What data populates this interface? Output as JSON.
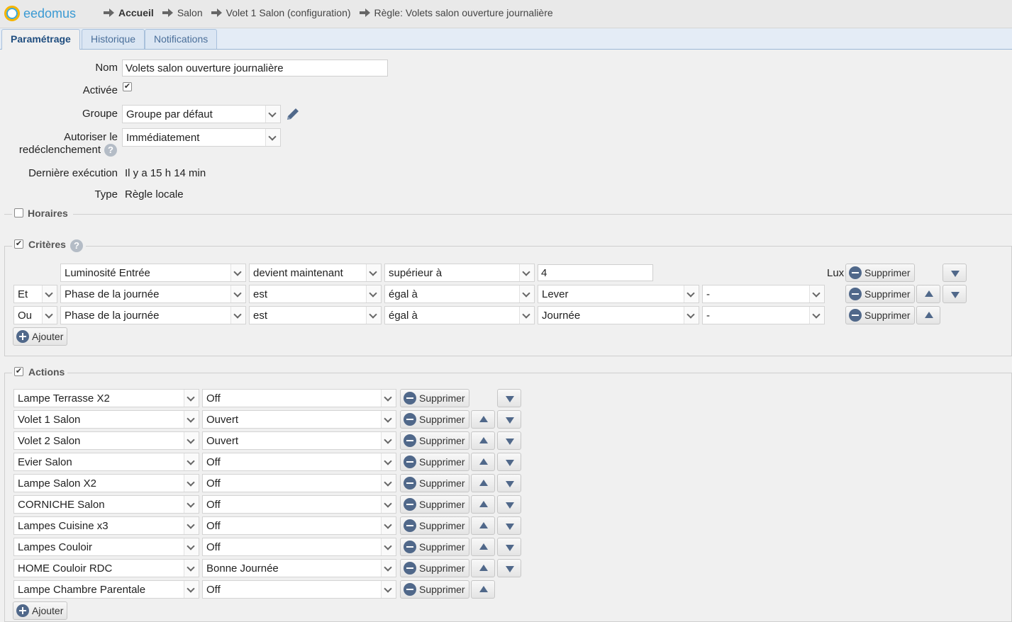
{
  "app": {
    "name": "eedomus"
  },
  "breadcrumb": [
    "Accueil",
    "Salon",
    "Volet 1 Salon (configuration)",
    "Règle: Volets salon ouverture journalière"
  ],
  "tabs": [
    "Paramétrage",
    "Historique",
    "Notifications"
  ],
  "form": {
    "nom_label": "Nom",
    "nom_value": "Volets salon ouverture journalière",
    "activee_label": "Activée",
    "activee_checked": true,
    "groupe_label": "Groupe",
    "groupe_value": "Groupe par défaut",
    "autoriser_label_1": "Autoriser le",
    "autoriser_label_2": "redéclenchement",
    "autoriser_value": "Immédiatement",
    "derniere_label": "Dernière exécution",
    "derniere_value": "Il y a 15 h 14 min",
    "type_label": "Type",
    "type_value": "Règle locale"
  },
  "sections": {
    "horaires": "Horaires",
    "criteres": "Critères",
    "actions": "Actions"
  },
  "criteria": [
    {
      "conj": "",
      "device": "Luminosité Entrée",
      "verb": "devient maintenant",
      "op": "supérieur à",
      "value": "4",
      "unit": "Lux"
    },
    {
      "conj": "Et",
      "device": "Phase de la journée",
      "verb": "est",
      "op": "égal à",
      "value": "Lever",
      "extra": "-"
    },
    {
      "conj": "Ou",
      "device": "Phase de la journée",
      "verb": "est",
      "op": "égal à",
      "value": "Journée",
      "extra": "-"
    }
  ],
  "actions": [
    {
      "device": "Lampe Terrasse X2",
      "value": "Off"
    },
    {
      "device": "Volet 1 Salon",
      "value": "Ouvert"
    },
    {
      "device": "Volet 2 Salon",
      "value": "Ouvert"
    },
    {
      "device": "Evier Salon",
      "value": "Off"
    },
    {
      "device": "Lampe Salon X2",
      "value": "Off"
    },
    {
      "device": "CORNICHE Salon",
      "value": "Off"
    },
    {
      "device": "Lampes Cuisine x3",
      "value": "Off"
    },
    {
      "device": "Lampes Couloir",
      "value": "Off"
    },
    {
      "device": "HOME Couloir RDC",
      "value": "Bonne Journée"
    },
    {
      "device": "Lampe Chambre Parentale",
      "value": "Off"
    }
  ],
  "buttons": {
    "supprimer": "Supprimer",
    "ajouter": "Ajouter"
  },
  "colors": {
    "accent": "#3a9ad3",
    "button_icon": "#50688a"
  }
}
